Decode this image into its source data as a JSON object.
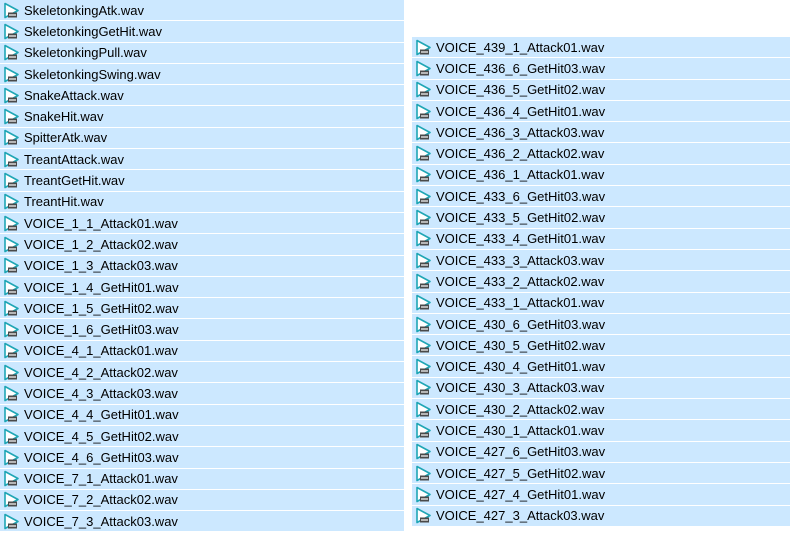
{
  "colors": {
    "selection_background": "#cce8ff",
    "icon_play": "#1fa6b5",
    "text": "#000000"
  },
  "file_icon": "wav-audio-file-icon",
  "left_column": {
    "files": [
      "SkeletonkingAtk.wav",
      "SkeletonkingGetHit.wav",
      "SkeletonkingPull.wav",
      "SkeletonkingSwing.wav",
      "SnakeAttack.wav",
      "SnakeHit.wav",
      "SpitterAtk.wav",
      "TreantAttack.wav",
      "TreantGetHit.wav",
      "TreantHit.wav",
      "VOICE_1_1_Attack01.wav",
      "VOICE_1_2_Attack02.wav",
      "VOICE_1_3_Attack03.wav",
      "VOICE_1_4_GetHit01.wav",
      "VOICE_1_5_GetHit02.wav",
      "VOICE_1_6_GetHit03.wav",
      "VOICE_4_1_Attack01.wav",
      "VOICE_4_2_Attack02.wav",
      "VOICE_4_3_Attack03.wav",
      "VOICE_4_4_GetHit01.wav",
      "VOICE_4_5_GetHit02.wav",
      "VOICE_4_6_GetHit03.wav",
      "VOICE_7_1_Attack01.wav",
      "VOICE_7_2_Attack02.wav",
      "VOICE_7_3_Attack03.wav"
    ]
  },
  "right_column": {
    "files": [
      "VOICE_439_1_Attack01.wav",
      "VOICE_436_6_GetHit03.wav",
      "VOICE_436_5_GetHit02.wav",
      "VOICE_436_4_GetHit01.wav",
      "VOICE_436_3_Attack03.wav",
      "VOICE_436_2_Attack02.wav",
      "VOICE_436_1_Attack01.wav",
      "VOICE_433_6_GetHit03.wav",
      "VOICE_433_5_GetHit02.wav",
      "VOICE_433_4_GetHit01.wav",
      "VOICE_433_3_Attack03.wav",
      "VOICE_433_2_Attack02.wav",
      "VOICE_433_1_Attack01.wav",
      "VOICE_430_6_GetHit03.wav",
      "VOICE_430_5_GetHit02.wav",
      "VOICE_430_4_GetHit01.wav",
      "VOICE_430_3_Attack03.wav",
      "VOICE_430_2_Attack02.wav",
      "VOICE_430_1_Attack01.wav",
      "VOICE_427_6_GetHit03.wav",
      "VOICE_427_5_GetHit02.wav",
      "VOICE_427_4_GetHit01.wav",
      "VOICE_427_3_Attack03.wav"
    ]
  }
}
